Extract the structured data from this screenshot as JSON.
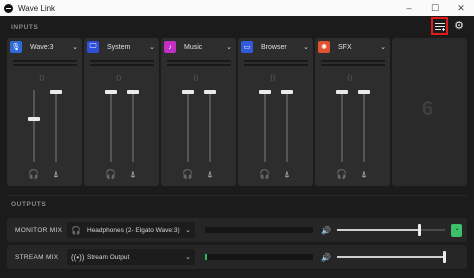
{
  "window": {
    "title": "Wave Link",
    "minimize": "–",
    "maximize": "☐",
    "close": "✕"
  },
  "sections": {
    "inputs": "INPUTS",
    "outputs": "OUTPUTS"
  },
  "toolbar": {
    "filter_icon": "filter-icon",
    "settings_icon": "gear-icon"
  },
  "channels": [
    {
      "name": "Wave:3",
      "icon_color": "#2f6ad9",
      "icon": "microphone-icon",
      "glyph": "🎙",
      "meter_level": 0.0,
      "monitor_level": 0.6,
      "stream_level": 1.0
    },
    {
      "name": "System",
      "icon_color": "#2f4fd9",
      "icon": "monitor-icon",
      "glyph": "🖵",
      "meter_level": 0.0,
      "monitor_level": 1.0,
      "stream_level": 1.0
    },
    {
      "name": "Music",
      "icon_color": "#c12fc4",
      "icon": "music-icon",
      "glyph": "♪",
      "meter_level": 0.0,
      "monitor_level": 1.0,
      "stream_level": 1.0
    },
    {
      "name": "Browser",
      "icon_color": "#2f5ad9",
      "icon": "browser-icon",
      "glyph": "▭",
      "meter_level": 0.0,
      "monitor_level": 1.0,
      "stream_level": 1.0
    },
    {
      "name": "SFX",
      "icon_color": "#e0532f",
      "icon": "sfx-icon",
      "glyph": "✺",
      "meter_level": 0.0,
      "monitor_level": 1.0,
      "stream_level": 1.0
    }
  ],
  "empty_slot": {
    "label": "6"
  },
  "outputs": {
    "monitor": {
      "label": "MONITOR MIX",
      "device": "Headphones (2- Elgato Wave:3)",
      "meter_level": 0.0,
      "volume": 0.77
    },
    "stream": {
      "label": "STREAM MIX",
      "device": "Stream Output",
      "meter_level": 0.02,
      "volume": 1.0
    }
  }
}
